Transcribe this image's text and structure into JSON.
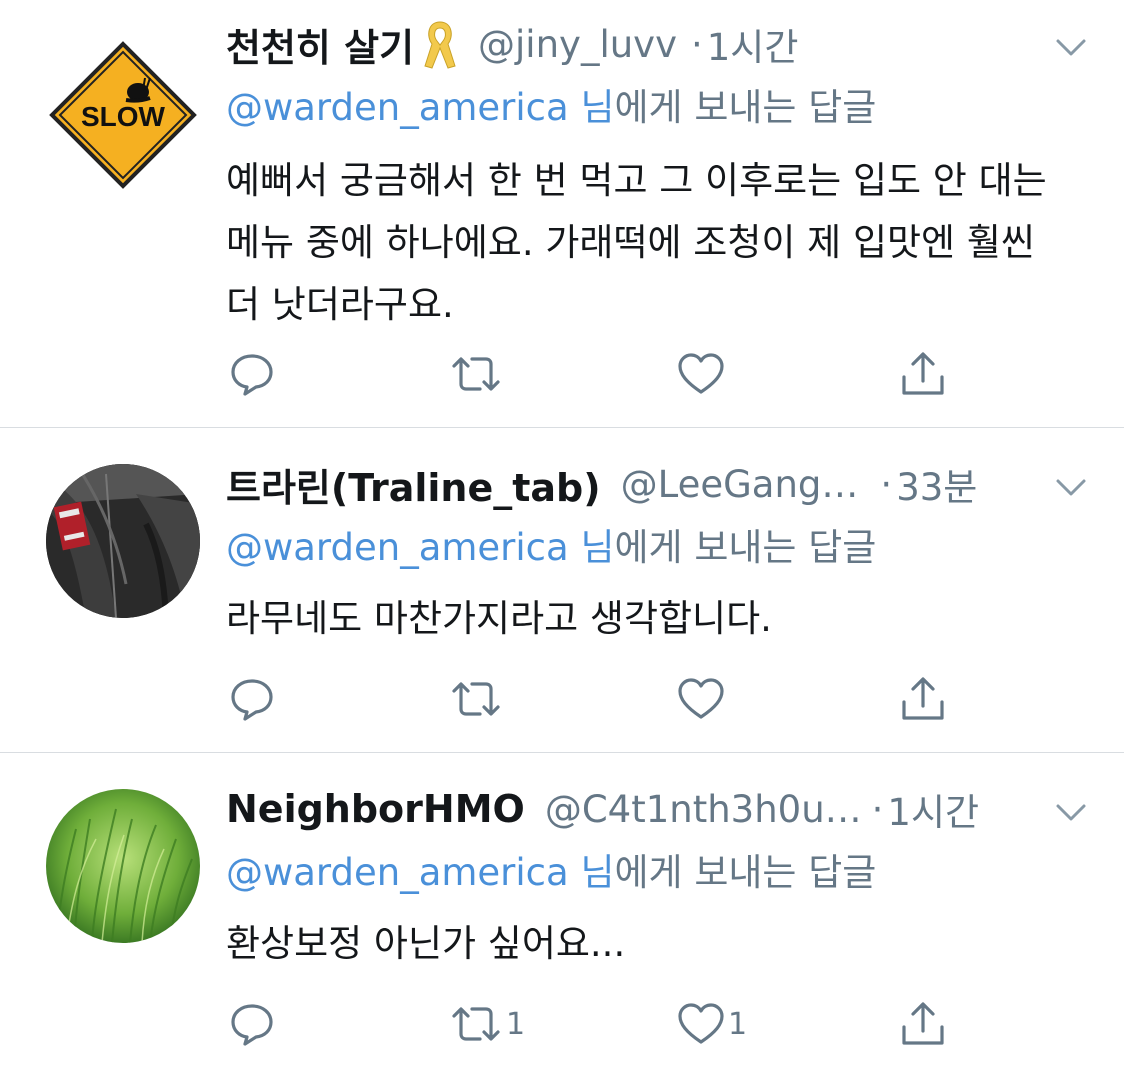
{
  "tweets": [
    {
      "display_name": "천천히 살기",
      "handle": "@jiny_luvv",
      "separator": "·",
      "time": "1시간",
      "reply_mention": "@warden_america 님",
      "reply_suffix": "에게 보내는 답글",
      "text": "예뻐서 궁금해서 한 번 먹고 그 이후로는 입도 안 대는 메뉴 중에 하나에요. 가래떡에 조청이 제 입맛엔 훨씬 더 낫더라구요.",
      "retweet_count": "",
      "like_count": "",
      "avatar_sign_text": "SLOW"
    },
    {
      "display_name": "트라린(Traline_tab)",
      "handle": "@LeeGang…",
      "separator": "·",
      "time": "33분",
      "reply_mention": "@warden_america 님",
      "reply_suffix": "에게 보내는 답글",
      "text": "라무네도 마찬가지라고 생각합니다.",
      "retweet_count": "",
      "like_count": ""
    },
    {
      "display_name": "NeighborHMO",
      "handle": "@C4t1nth3h0u…",
      "separator": "·",
      "time": "1시간",
      "reply_mention": "@warden_america 님",
      "reply_suffix": "에게 보내는 답글",
      "text": "환상보정 아닌가 싶어요...",
      "retweet_count": "1",
      "like_count": "1"
    }
  ],
  "icons": {
    "reply": "reply-icon",
    "retweet": "retweet-icon",
    "like": "heart-icon",
    "share": "share-icon",
    "more": "chevron-down-icon",
    "ribbon": "yellow-ribbon-icon"
  },
  "colors": {
    "mention": "#4a90d9",
    "secondary_text": "#657786",
    "primary_text": "#14171a",
    "divider": "#d9dde1"
  }
}
